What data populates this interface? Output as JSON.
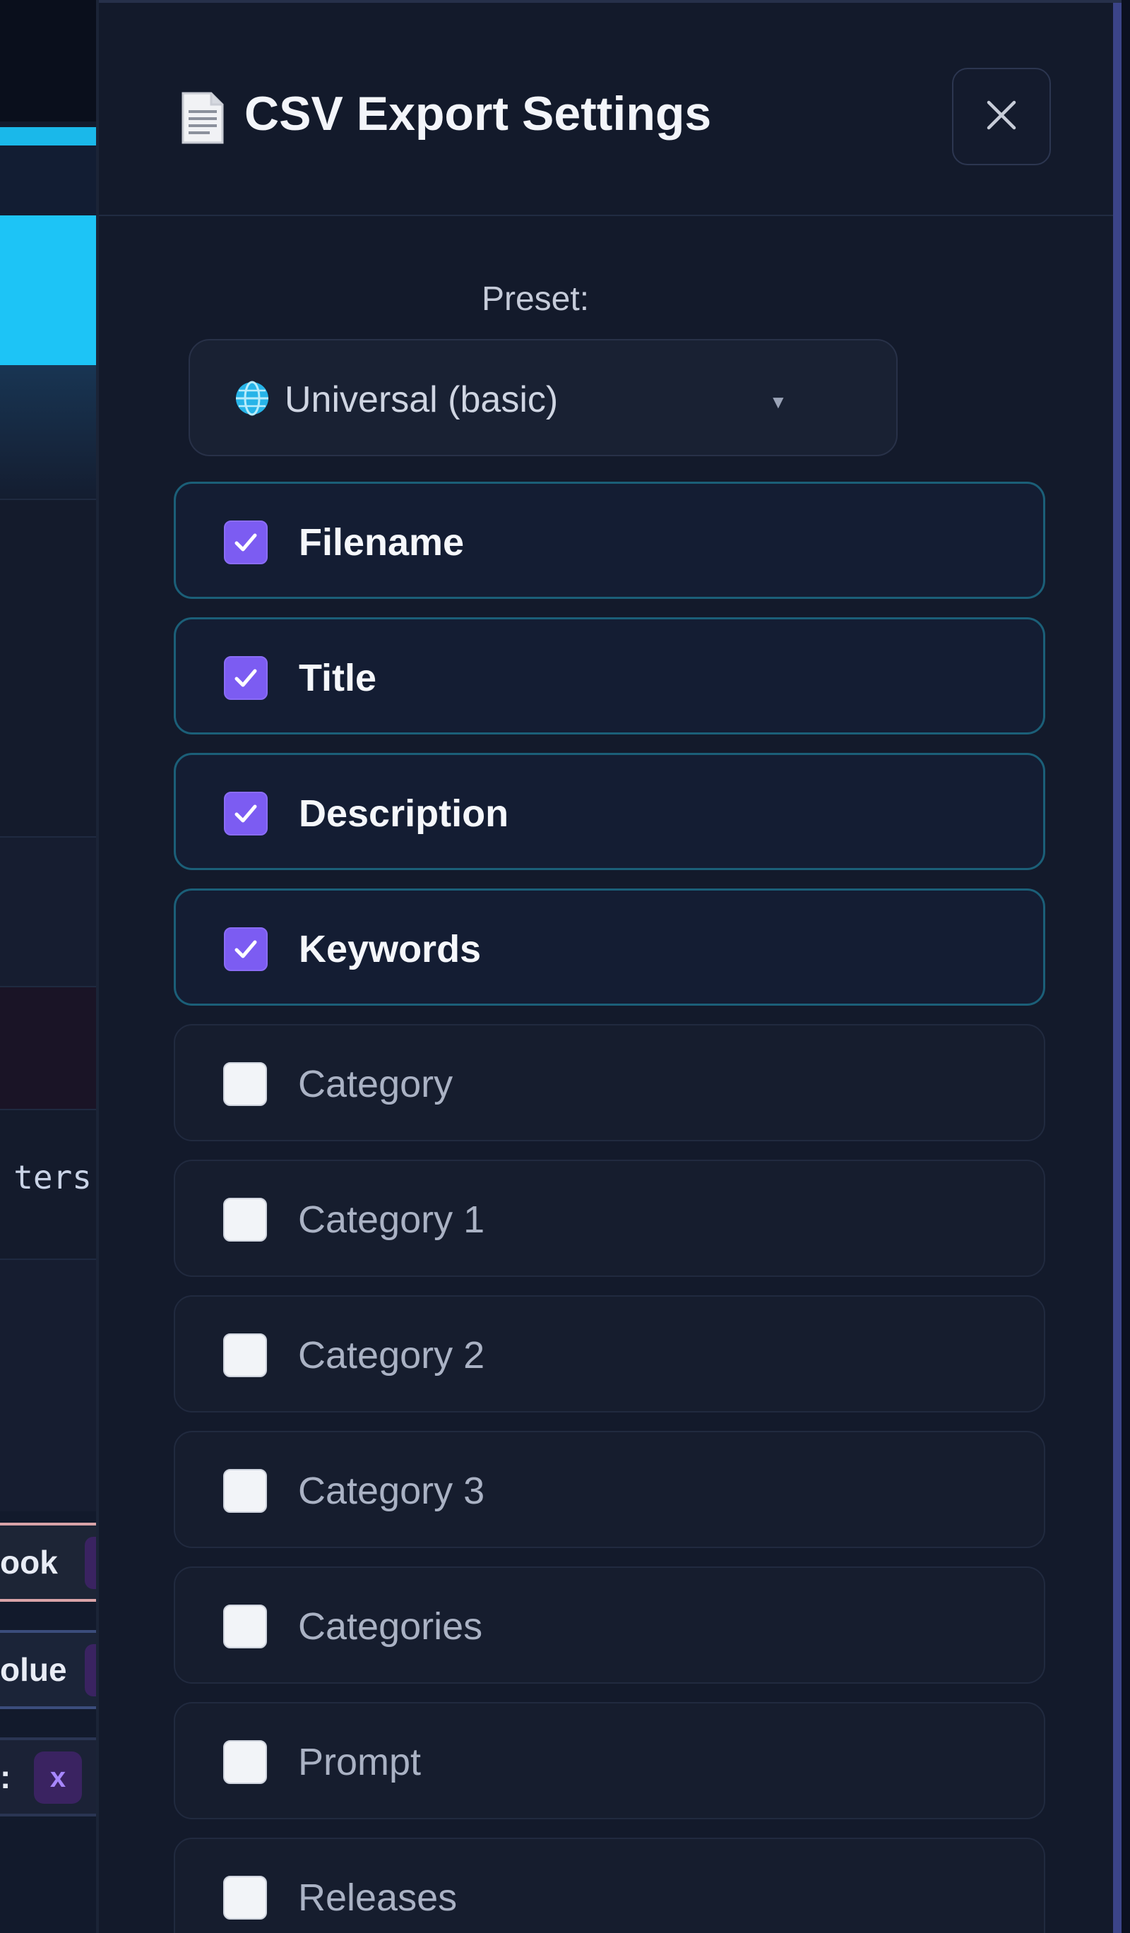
{
  "background": {
    "code_fragment": "ters",
    "tags": [
      "ook",
      "olue",
      ":"
    ],
    "remove_label": "x"
  },
  "dialog": {
    "title": "CSV Export Settings",
    "title_icon": "document-icon",
    "close_icon": "close-icon",
    "preset": {
      "label": "Preset:",
      "selected": "Universal (basic)",
      "icon": "globe-icon"
    },
    "fields": [
      {
        "label": "Filename",
        "checked": true
      },
      {
        "label": "Title",
        "checked": true
      },
      {
        "label": "Description",
        "checked": true
      },
      {
        "label": "Keywords",
        "checked": true
      },
      {
        "label": "Category",
        "checked": false
      },
      {
        "label": "Category 1",
        "checked": false
      },
      {
        "label": "Category 2",
        "checked": false
      },
      {
        "label": "Category 3",
        "checked": false
      },
      {
        "label": "Categories",
        "checked": false
      },
      {
        "label": "Prompt",
        "checked": false
      },
      {
        "label": "Releases",
        "checked": false
      }
    ]
  },
  "colors": {
    "accent": "#7c5cf2",
    "checked_border": "#1b5f78",
    "panel_bg": "#131a2b",
    "cyan": "#1dc4f6"
  }
}
